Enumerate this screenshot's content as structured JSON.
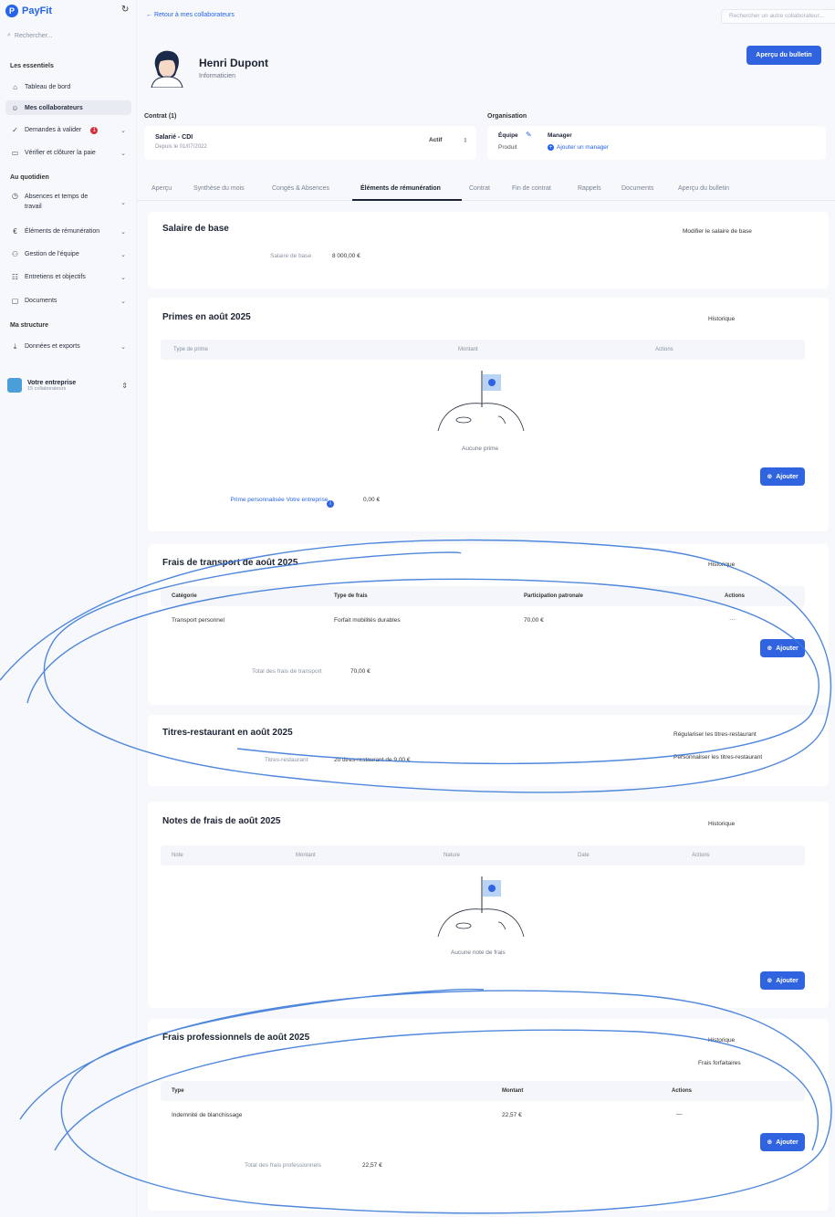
{
  "app": {
    "name": "PayFit"
  },
  "sidebar": {
    "search_placeholder": "Rechercher...",
    "sections": {
      "essentiels": "Les essentiels",
      "quotidien": "Au quotidien",
      "structure": "Ma structure"
    },
    "items": [
      {
        "label": "Tableau de bord",
        "icon": "home-icon"
      },
      {
        "label": "Mes collaborateurs",
        "icon": "user-icon"
      },
      {
        "label": "Demandes à valider",
        "icon": "check-circle-icon",
        "badge": "1"
      },
      {
        "label": "Vérifier et clôturer la paie",
        "icon": "payslip-icon"
      },
      {
        "label": "Absences et temps de travail",
        "icon": "clock-icon"
      },
      {
        "label": "Éléments de rémunération",
        "icon": "euro-icon"
      },
      {
        "label": "Gestion de l'équipe",
        "icon": "team-icon"
      },
      {
        "label": "Entretiens et objectifs",
        "icon": "target-icon"
      },
      {
        "label": "Documents",
        "icon": "folder-icon"
      },
      {
        "label": "Données et exports",
        "icon": "download-icon"
      }
    ],
    "company": {
      "name": "Votre entreprise",
      "sub": "15 collaborateurs"
    }
  },
  "header": {
    "back_link": "← Retour à mes collaborateurs",
    "search_placeholder": "Rechercher un autre collaborateur...",
    "employee_name": "Henri Dupont",
    "employee_role": "Informaticien",
    "preview_button": "Aperçu du bulletin"
  },
  "contract": {
    "label": "Contrat (1)",
    "title": "Salarié - CDI",
    "since": "Depuis le 01/07/2022",
    "status": "Actif"
  },
  "organisation": {
    "label": "Organisation",
    "team_label": "Équipe",
    "product_label": "Produit",
    "manager_label": "Manager",
    "add_manager": "Ajouter un manager"
  },
  "tabs": [
    {
      "label": "Aperçu"
    },
    {
      "label": "Synthèse du mois"
    },
    {
      "label": "Congés & Absences"
    },
    {
      "label": "Éléments de rémunération"
    },
    {
      "label": "Contrat"
    },
    {
      "label": "Fin de contrat"
    },
    {
      "label": "Rappels"
    },
    {
      "label": "Documents"
    },
    {
      "label": "Aperçu du bulletin"
    }
  ],
  "salary": {
    "title": "Salaire de base",
    "edit_button": "Modifier le salaire de base",
    "row_label": "Salaire de base",
    "row_value": "8 000,00 €"
  },
  "primes": {
    "title": "Primes en août 2025",
    "history_button": "Historique",
    "columns": [
      "Type de prime",
      "Montant",
      "Actions"
    ],
    "empty_text": "Aucune prime",
    "add_button": "Ajouter",
    "custom_label": "Prime personnalisée Votre entreprise",
    "custom_value": "0,00 €"
  },
  "transport": {
    "title": "Frais de transport de août 2025",
    "history_button": "Historique",
    "columns": [
      "Catégorie",
      "Type de frais",
      "Participation patronale",
      "Actions"
    ],
    "rows": [
      {
        "category": "Transport personnel",
        "type": "Forfait mobilités durables",
        "amount": "70,00 €",
        "actions": "···"
      }
    ],
    "add_button": "Ajouter",
    "total_label": "Total des frais de transport",
    "total_value": "70,00 €"
  },
  "meal": {
    "title": "Titres-restaurant en août 2025",
    "regularize_button": "Régulariser les titres-restaurant",
    "customize_button": "Personnaliser les titres-restaurant",
    "row_label": "Titres-restaurant",
    "row_value": "20 titres-restaurant de 9,00 €"
  },
  "expenses": {
    "title": "Notes de frais de août 2025",
    "history_button": "Historique",
    "columns": [
      "Note",
      "Montant",
      "Nature",
      "Date",
      "Actions"
    ],
    "empty_text": "Aucune note de frais",
    "add_button": "Ajouter"
  },
  "pro_fees": {
    "title": "Frais professionnels de août 2025",
    "history_button": "Historique",
    "flat_button": "Frais forfaitaires",
    "columns": [
      "Type",
      "Montant",
      "Actions"
    ],
    "rows": [
      {
        "type": "Indemnité de blanchissage",
        "amount": "22,57 €",
        "actions": "—"
      }
    ],
    "add_button": "Ajouter",
    "total_label": "Total des frais professionnels",
    "total_value": "22,57 €"
  },
  "colors": {
    "accent": "#2f63df",
    "annotation": "#3d7bd9",
    "badge": "#d62f3c"
  }
}
